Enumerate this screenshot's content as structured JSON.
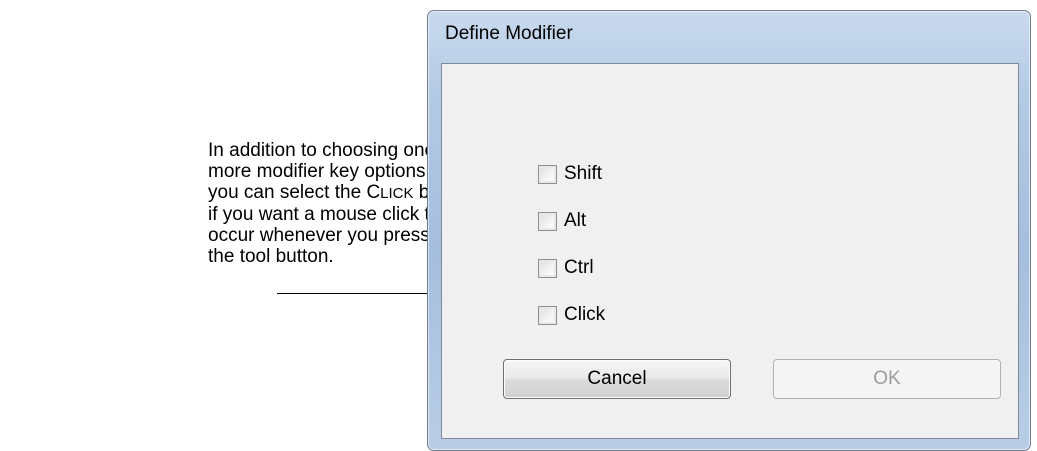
{
  "annotation": {
    "line1": "In addition to choosing one or",
    "line2": "more modifier key options,",
    "line3_pre": "you can select the ",
    "line3_sc_cap": "C",
    "line3_sc_rest": "LICK",
    "line3_post": " box",
    "line4": "if you want a mouse click to",
    "line5": "occur whenever you press",
    "line6": "the tool button."
  },
  "dialog": {
    "title": "Define Modifier",
    "checkboxes": [
      {
        "label": "Shift",
        "checked": false
      },
      {
        "label": "Alt",
        "checked": false
      },
      {
        "label": "Ctrl",
        "checked": false
      },
      {
        "label": "Click",
        "checked": false
      }
    ],
    "cancel_label": "Cancel",
    "ok_label": "OK",
    "ok_enabled": false
  }
}
